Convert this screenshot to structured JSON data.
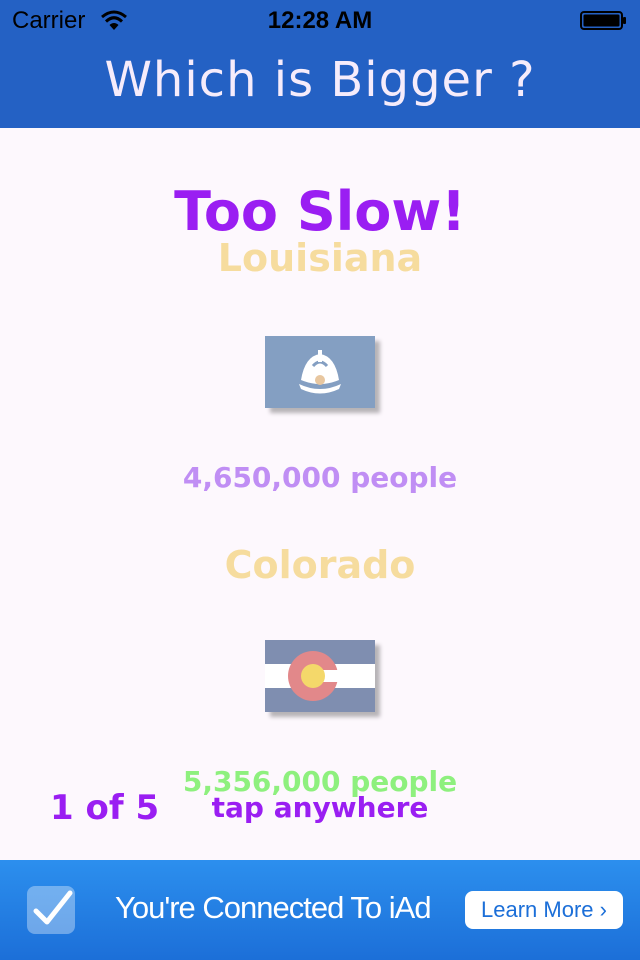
{
  "status_bar": {
    "carrier": "Carrier",
    "time": "12:28 AM"
  },
  "nav": {
    "title": "Which is Bigger ?"
  },
  "main": {
    "result": "Too Slow!",
    "state1": {
      "name": "Louisiana",
      "population": "4,650,000 people",
      "flag_icon": "louisiana-flag-icon"
    },
    "state2": {
      "name": "Colorado",
      "population": "5,356,000 people",
      "flag_icon": "colorado-flag-icon"
    },
    "progress": "1 of 5",
    "hint": "tap anywhere"
  },
  "ad": {
    "text": "You're Connected To iAd",
    "button": "Learn More ›"
  },
  "colors": {
    "bar_blue": "#2461c4",
    "accent_purple": "#9a1ef2",
    "name_gold": "#f6dc9e",
    "pop1_lavender": "#c08ef4",
    "pop2_green": "#8ef07e",
    "ad_blue": "#2c8fee"
  }
}
